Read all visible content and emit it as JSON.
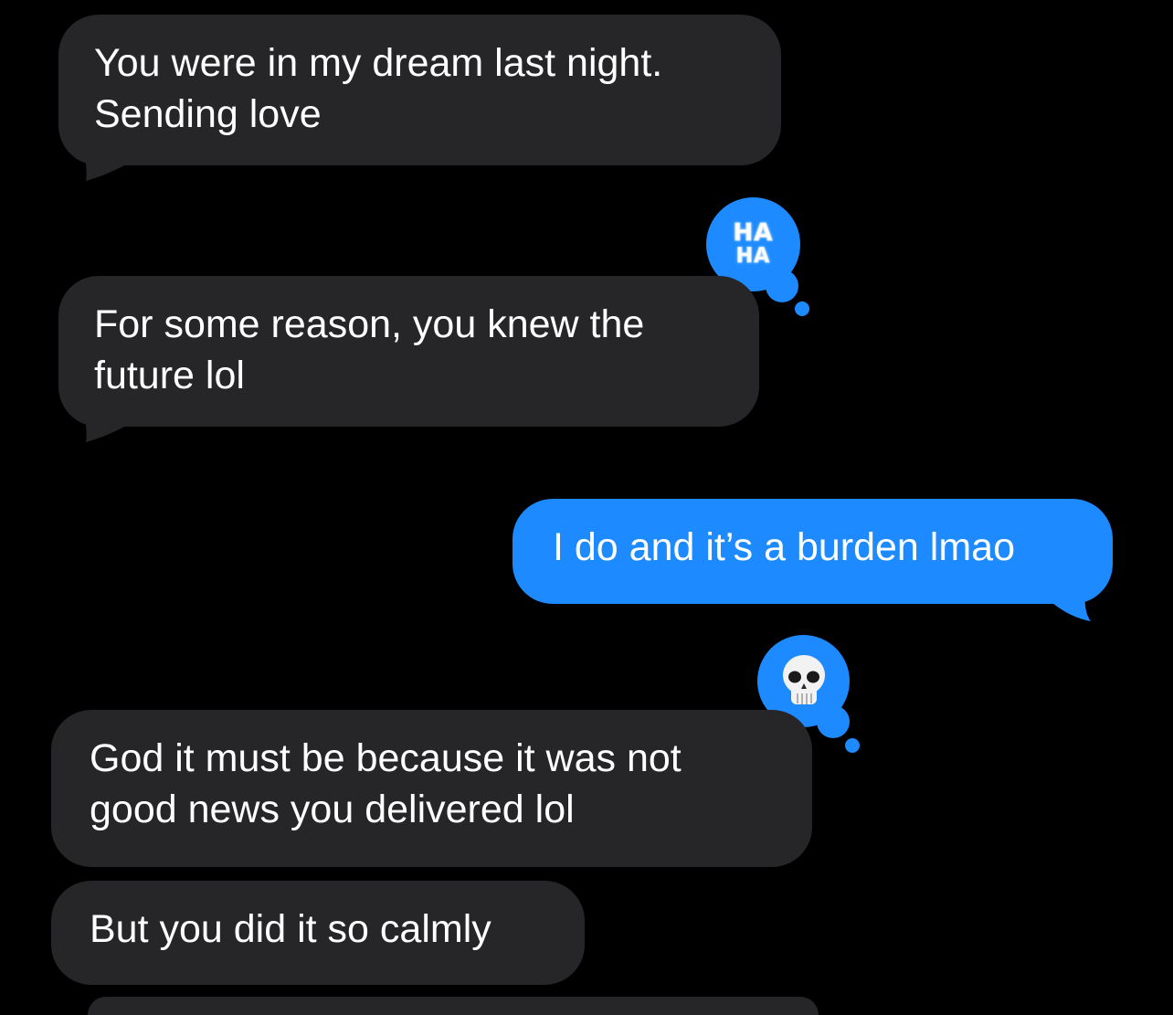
{
  "messages": [
    {
      "direction": "received",
      "text": "You were in my dream last night.\nSending love"
    },
    {
      "direction": "received",
      "text": "For some reason, you knew the\nfuture lol",
      "tapback": {
        "type": "haha",
        "line1": "HA",
        "line2": "HA"
      }
    },
    {
      "direction": "sent",
      "text": "I do and it’s a burden lmao"
    },
    {
      "direction": "received",
      "text": "God it must be because it was not\ngood news you delivered lol",
      "tapback": {
        "type": "emoji",
        "icon": "skull-icon"
      }
    },
    {
      "direction": "received",
      "text": "But you did it so calmly"
    }
  ],
  "colors": {
    "background": "#000000",
    "received_bubble": "#262628",
    "sent_bubble": "#1d8bff",
    "tapback": "#1d8bff",
    "text": "#ffffff"
  }
}
